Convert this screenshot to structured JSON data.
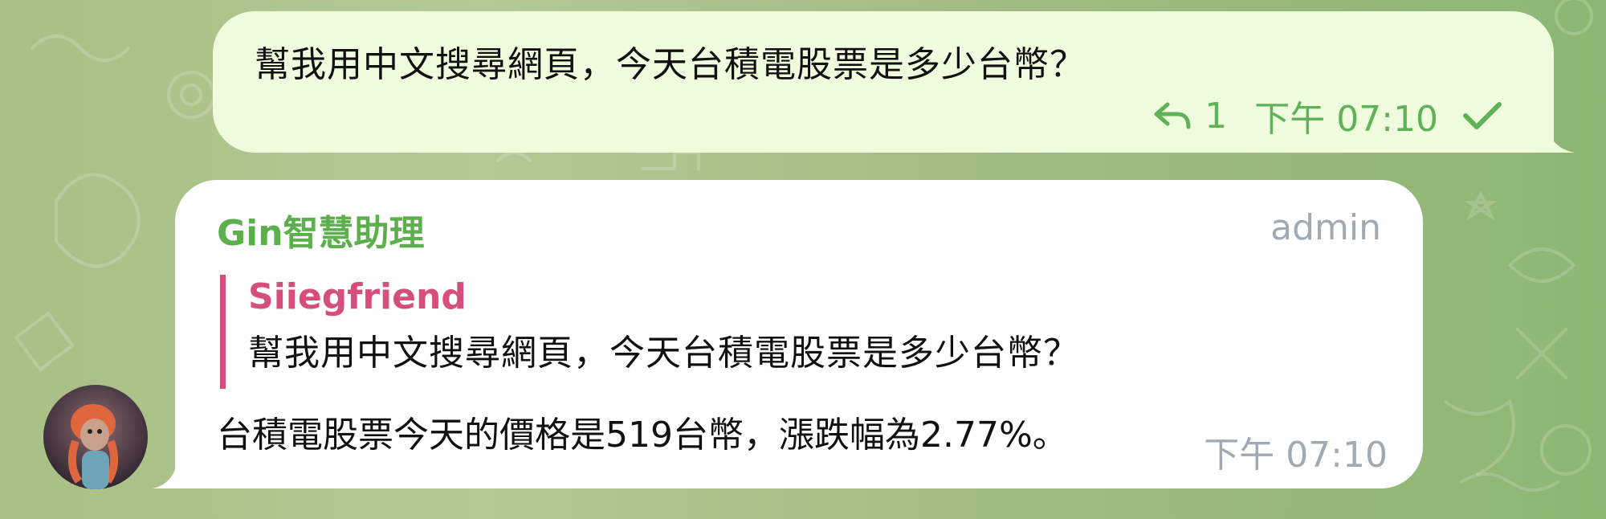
{
  "outgoing_message": {
    "text": "幫我用中文搜尋網頁，今天台積電股票是多少台幣？",
    "reply_icon": "reply-arrow-icon",
    "reply_count": "1",
    "time": "下午 07:10",
    "status_icon": "check-icon"
  },
  "incoming_message": {
    "sender": "Gin智慧助理",
    "role": "admin",
    "quote": {
      "author": "Siiegfriend",
      "text": "幫我用中文搜尋網頁，今天台積電股票是多少台幣？"
    },
    "text": "台積電股票今天的價格是519台幣，漲跌幅為2.77%。",
    "time": "下午 07:10"
  },
  "colors": {
    "outgoing_bubble": "#effdde",
    "incoming_bubble": "#ffffff",
    "accent_green": "#5fb257",
    "sender_green": "#5caf4c",
    "quote_pink": "#d64f7c",
    "meta_gray": "#a1aab3"
  }
}
